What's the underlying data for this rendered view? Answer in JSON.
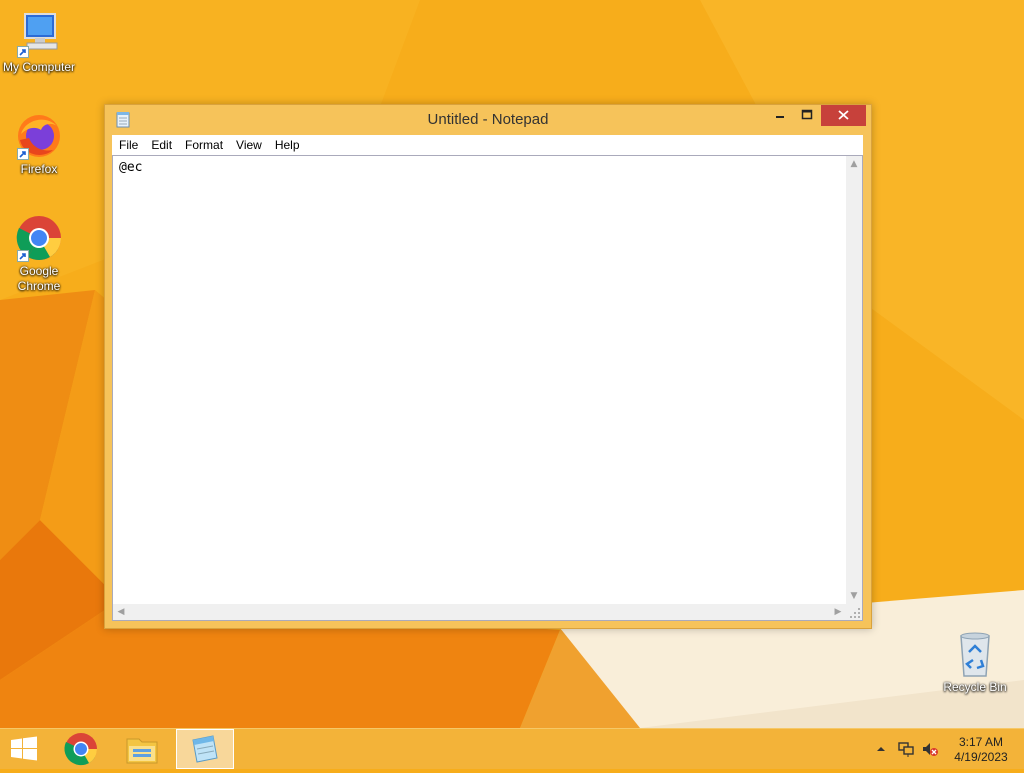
{
  "desktop": {
    "icons": [
      {
        "label": "My Computer",
        "icon": "computer-icon"
      },
      {
        "label": "Firefox",
        "icon": "firefox-icon"
      },
      {
        "label": "Google Chrome",
        "icon": "chrome-icon"
      },
      {
        "label": "Recycle Bin",
        "icon": "recycle-bin-icon"
      }
    ]
  },
  "window": {
    "title": "Untitled - Notepad",
    "menu": [
      "File",
      "Edit",
      "Format",
      "View",
      "Help"
    ],
    "content": "@ec"
  },
  "taskbar": {
    "items": [
      "start-icon",
      "chrome-icon",
      "file-explorer-icon",
      "notepad-icon"
    ],
    "clock": {
      "time": "3:17 AM",
      "date": "4/19/2023"
    }
  },
  "colors": {
    "wallpaper": "#f7ad1b",
    "window_frame": "#f6c35a",
    "close_button": "#c7413b",
    "taskbar": "#f3b339"
  }
}
